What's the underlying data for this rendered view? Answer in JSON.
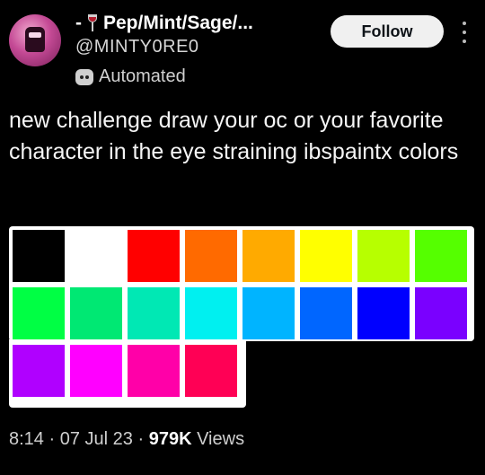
{
  "author": {
    "display_name": "Pep/Mint/Sage/...",
    "name_prefix": "-",
    "handle": "@MINTY0RE0",
    "badge": "Automated",
    "glass_icon": "wine-glass-icon"
  },
  "actions": {
    "follow_label": "Follow"
  },
  "tweet": {
    "text": "new challenge draw your oc or your favorite character in the eye straining ibspaintx colors"
  },
  "palette": {
    "rows": [
      [
        "#000000",
        "#ffffff",
        "#ff0000",
        "#ff6a00",
        "#ffaa00",
        "#ffff00",
        "#b7ff00",
        "#55ff00"
      ],
      [
        "#00ff44",
        "#00e873",
        "#00e8b4",
        "#00f0f0",
        "#00b4ff",
        "#0066ff",
        "#0000ff",
        "#7a00ff"
      ],
      [
        "#b000ff",
        "#ff00ff",
        "#ff00a8",
        "#ff0055"
      ]
    ]
  },
  "meta": {
    "time": "8:14",
    "date": "07 Jul 23",
    "views_count": "979K",
    "views_label": "Views",
    "sep": "·"
  }
}
